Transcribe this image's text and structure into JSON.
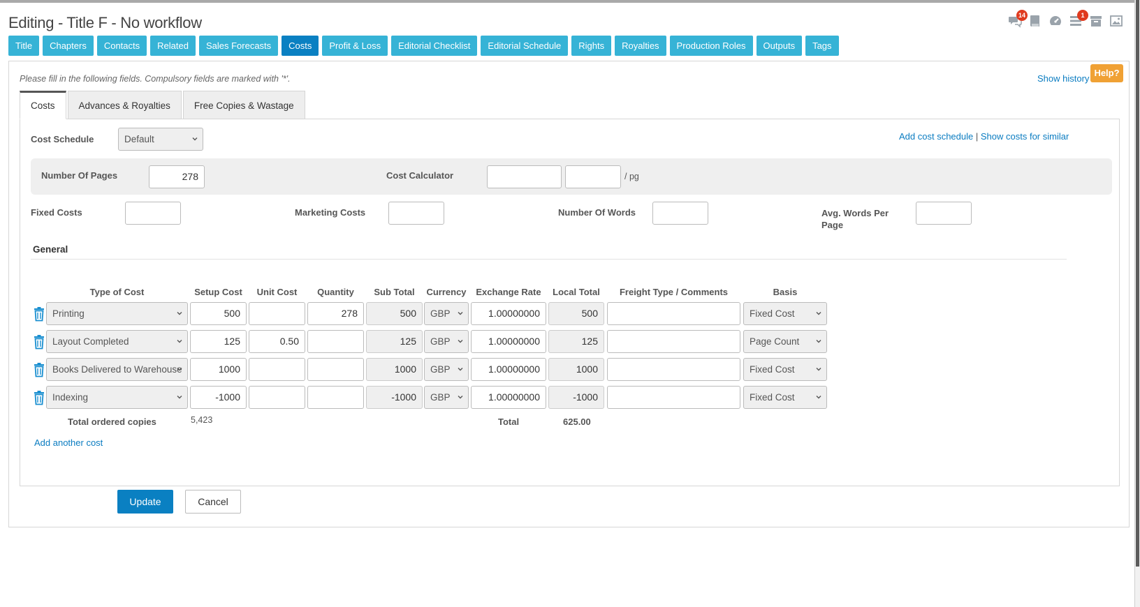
{
  "page_title": "Editing - Title F - No workflow",
  "header_icons": [
    {
      "name": "comments-icon",
      "badge": "14"
    },
    {
      "name": "book-icon",
      "badge": ""
    },
    {
      "name": "dashboard-icon",
      "badge": ""
    },
    {
      "name": "tasks-icon",
      "badge": "1"
    },
    {
      "name": "archive-icon",
      "badge": ""
    },
    {
      "name": "image-icon",
      "badge": ""
    }
  ],
  "nav_tabs": [
    "Title",
    "Chapters",
    "Contacts",
    "Related",
    "Sales Forecasts",
    "Costs",
    "Profit & Loss",
    "Editorial Checklist",
    "Editorial Schedule",
    "Rights",
    "Royalties",
    "Production Roles",
    "Outputs",
    "Tags"
  ],
  "nav_active": "Costs",
  "instructions": "Please fill in the following fields. Compulsory fields are marked with '*'.",
  "show_history": "Show history",
  "help": "Help?",
  "subtabs": [
    "Costs",
    "Advances & Royalties",
    "Free Copies & Wastage"
  ],
  "cost_schedule": {
    "label": "Cost Schedule",
    "value": "Default"
  },
  "links": {
    "add_cost_schedule": "Add cost schedule",
    "separator": "|",
    "show_costs_similar": "Show costs for similar"
  },
  "calc": {
    "pages_label": "Number Of Pages",
    "pages_value": "278",
    "calculator_label": "Cost Calculator",
    "calc_value_1": "",
    "calc_value_2": "",
    "per_pg": "/ pg"
  },
  "fields": {
    "fixed_costs_label": "Fixed Costs",
    "fixed_costs": "",
    "marketing_costs_label": "Marketing Costs",
    "marketing_costs": "",
    "number_of_words_label": "Number Of Words",
    "number_of_words": "",
    "avg_words_label_1": "Avg. Words Per",
    "avg_words_label_2": "Page",
    "avg_words": ""
  },
  "general_title": "General",
  "table": {
    "headers": [
      "Type of Cost",
      "Setup Cost",
      "Unit Cost",
      "Quantity",
      "Sub Total",
      "Currency",
      "Exchange Rate",
      "Local Total",
      "Freight Type / Comments",
      "Basis"
    ],
    "rows": [
      {
        "type": "Printing",
        "setup": "500",
        "unit": "",
        "qty": "278",
        "subtotal": "500",
        "currency": "GBP",
        "rate": "1.00000000",
        "local": "500",
        "comments": "",
        "basis": "Fixed Cost"
      },
      {
        "type": "Layout Completed",
        "setup": "125",
        "unit": "0.50",
        "qty": "",
        "subtotal": "125",
        "currency": "GBP",
        "rate": "1.00000000",
        "local": "125",
        "comments": "",
        "basis": "Page Count"
      },
      {
        "type": "Books Delivered to Warehouse",
        "setup": "1000",
        "unit": "",
        "qty": "",
        "subtotal": "1000",
        "currency": "GBP",
        "rate": "1.00000000",
        "local": "1000",
        "comments": "",
        "basis": "Fixed Cost"
      },
      {
        "type": "Indexing",
        "setup": "-1000",
        "unit": "",
        "qty": "",
        "subtotal": "-1000",
        "currency": "GBP",
        "rate": "1.00000000",
        "local": "-1000",
        "comments": "",
        "basis": "Fixed Cost"
      }
    ]
  },
  "totals": {
    "ordered_label": "Total ordered copies",
    "ordered_value": "5,423",
    "total_label": "Total",
    "total_value": "625.00"
  },
  "add_another_cost": "Add another cost",
  "buttons": {
    "update": "Update",
    "cancel": "Cancel"
  },
  "colors": {
    "accent": "#36b3d6",
    "active": "#0a80c2",
    "help": "#f0a134",
    "badge": "#e03b1f",
    "link": "#0a7cc1"
  }
}
